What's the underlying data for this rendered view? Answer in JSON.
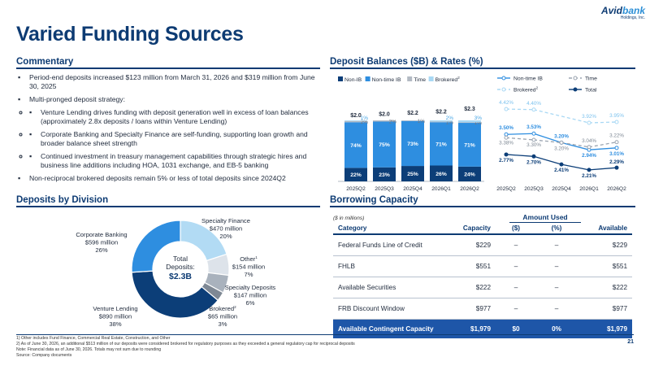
{
  "title": "Varied Funding Sources",
  "logo": {
    "brand_a": "Avid",
    "brand_b": "bank",
    "sub": "Holdings, Inc."
  },
  "page_number": "21",
  "commentary": {
    "title": "Commentary",
    "bullets": [
      "Period-end deposits increased $123 million from March 31, 2026 and $319 million from June 30, 2025",
      "Multi-pronged deposit strategy:",
      "Non-reciprocal brokered deposits remain 5% or less of total deposits since 2024Q2"
    ],
    "sub_bullets": [
      "Venture Lending drives funding with deposit generation well in excess of loan balances (approximately 2.8x deposits / loans within Venture Lending)",
      "Corporate Banking and Specialty Finance are self-funding, supporting loan growth and broader balance sheet strength",
      "Continued investment in treasury management capabilities through strategic hires and business line additions including HOA, 1031 exchange, and EB-5 banking"
    ]
  },
  "deposit_balances": {
    "title": "Deposit Balances ($B) & Rates (%)"
  },
  "deposits_by_division": {
    "title": "Deposits by Division",
    "center_label_1": "Total",
    "center_label_2": "Deposits:",
    "center_value": "$2.3B"
  },
  "borrowing": {
    "title": "Borrowing Capacity",
    "units_note": "($ in millions)",
    "amount_used_header": "Amount Used",
    "columns": [
      "Category",
      "Capacity",
      "($)",
      "(%)",
      "Available"
    ],
    "rows": [
      [
        "Federal Funds Line of Credit",
        "$229",
        "–",
        "–",
        "$229"
      ],
      [
        "FHLB",
        "$551",
        "–",
        "–",
        "$551"
      ],
      [
        "Available Securities",
        "$222",
        "–",
        "–",
        "$222"
      ],
      [
        "FRB Discount Window",
        "$977",
        "–",
        "–",
        "$977"
      ]
    ],
    "total_row": [
      "Available Contingent Capacity",
      "$1,979",
      "$0",
      "0%",
      "$1,979"
    ]
  },
  "footnotes": [
    "1)    Other includes Fund Finance, Commercial Real Estate, Construction, and Other",
    "2)    As of June 30, 2026, an additional $513 million of our deposits were considered brokered for regulatory purposes as they exceeded a general regulatory cap for reciprocal deposits",
    "Note: Financial data as of June 30, 2026. Totals may not sum due to rounding",
    "Source: Company documents"
  ],
  "colors": {
    "navy": "#0d3b73",
    "non_ib": "#0c3e78",
    "non_time_ib": "#2e8ee0",
    "time": "#b3bac3",
    "brokered": "#a8d8f4",
    "total_line": "#0c3e78"
  },
  "chart_data": [
    {
      "type": "bar",
      "stacked": true,
      "categories": [
        "2025Q2",
        "2025Q3",
        "2025Q4",
        "2026Q1",
        "2026Q2"
      ],
      "totals_label": [
        "$2.0",
        "$2.0",
        "$2.2",
        "$2.2",
        "$2.3"
      ],
      "series": [
        {
          "name": "Non-IB",
          "values": [
            22,
            23,
            25,
            26,
            24
          ],
          "labels": [
            "22%",
            "23%",
            "25%",
            "26%",
            "24%"
          ]
        },
        {
          "name": "Non-time IB",
          "values": [
            74,
            75,
            73,
            71,
            71
          ],
          "labels": [
            "74%",
            "75%",
            "73%",
            "71%",
            "71%"
          ]
        },
        {
          "name": "Time",
          "values": [
            2,
            2,
            1,
            1,
            1
          ],
          "labels": [
            "2%",
            "2%",
            "1%",
            "1%",
            "1%"
          ]
        },
        {
          "name": "Brokered",
          "values": [
            1,
            0,
            0,
            2,
            3
          ],
          "labels": [
            "1%",
            "",
            "",
            "2%",
            "3%"
          ]
        }
      ],
      "legend_position": "top",
      "legend_superscripts": {
        "Brokered": "2"
      }
    },
    {
      "type": "line",
      "categories": [
        "2025Q2",
        "2025Q3",
        "2025Q4",
        "2026Q1",
        "2026Q2"
      ],
      "series": [
        {
          "name": "Non-time IB",
          "values": [
            3.5,
            3.53,
            3.2,
            2.94,
            3.01
          ],
          "labels": [
            "3.50%",
            "3.53%",
            "3.20%",
            "2.94%",
            "3.01%"
          ]
        },
        {
          "name": "Time",
          "values": [
            3.38,
            3.3,
            3.2,
            3.04,
            3.22
          ],
          "labels": [
            "3.38%",
            "3.30%",
            "3.20%",
            "3.04%",
            "3.22%"
          ]
        },
        {
          "name": "Brokered",
          "values": [
            4.42,
            4.4,
            null,
            3.92,
            3.95
          ],
          "labels": [
            "4.42%",
            "4.40%",
            "",
            "3.92%",
            "3.95%"
          ]
        },
        {
          "name": "Total",
          "values": [
            2.77,
            2.7,
            2.41,
            2.21,
            2.29
          ],
          "labels": [
            "2.77%",
            "2.70%",
            "2.41%",
            "2.21%",
            "2.29%"
          ]
        }
      ],
      "legend_position": "top",
      "legend_superscripts": {
        "Brokered": "2"
      },
      "ylim": [
        2.0,
        4.6
      ]
    },
    {
      "type": "pie",
      "donut": true,
      "slices": [
        {
          "name": "Specialty Finance",
          "amount": "$470 million",
          "pct": "20%",
          "value": 20,
          "color": "#b2dbf4",
          "superscript": ""
        },
        {
          "name": "Other",
          "amount": "$154 million",
          "pct": "7%",
          "value": 7,
          "color": "#dde3ea",
          "superscript": "1"
        },
        {
          "name": "Specialty Deposits",
          "amount": "$147 million",
          "pct": "6%",
          "value": 6,
          "color": "#a9b2bd",
          "superscript": ""
        },
        {
          "name": "Brokered",
          "amount": "$65 million",
          "pct": "3%",
          "value": 3,
          "color": "#7e8894",
          "superscript": "2"
        },
        {
          "name": "Venture Lending",
          "amount": "$890 million",
          "pct": "38%",
          "value": 38,
          "color": "#0c3e78",
          "superscript": ""
        },
        {
          "name": "Corporate Banking",
          "amount": "$596 million",
          "pct": "26%",
          "value": 26,
          "color": "#2e8ee0",
          "superscript": ""
        }
      ]
    }
  ]
}
